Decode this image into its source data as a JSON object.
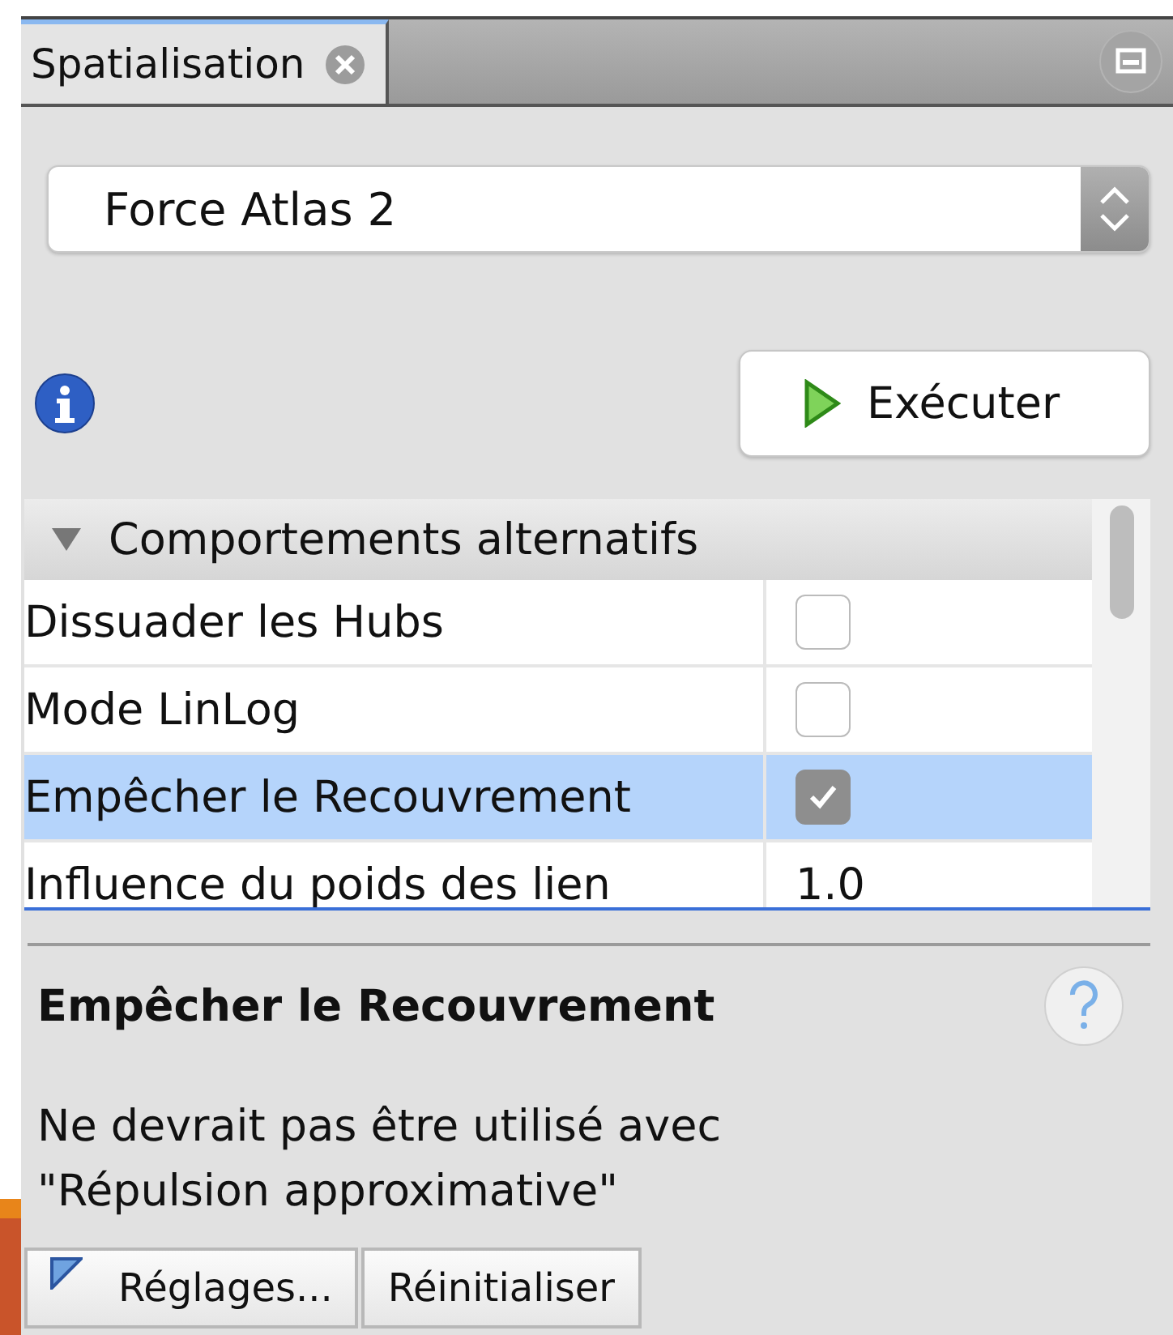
{
  "tab": {
    "label": "Spatialisation"
  },
  "algorithm_select": {
    "value": "Force Atlas 2"
  },
  "run_button": {
    "label": "Exécuter"
  },
  "properties": {
    "group": {
      "label": "Comportements alternatifs",
      "expanded": true
    },
    "rows": [
      {
        "name": "Dissuader les Hubs",
        "kind": "checkbox",
        "checked": false,
        "selected": false
      },
      {
        "name": "Mode LinLog",
        "kind": "checkbox",
        "checked": false,
        "selected": false
      },
      {
        "name": "Empêcher le Recouvrement",
        "kind": "checkbox",
        "checked": true,
        "selected": true
      },
      {
        "name": "Influence du poids des lien",
        "kind": "text",
        "value": "1.0",
        "selected": false
      }
    ]
  },
  "description": {
    "title": "Empêcher le Recouvrement",
    "lines": [
      "Ne devrait pas être utilisé avec",
      "\"Répulsion approximative\""
    ]
  },
  "buttons": [
    {
      "label": "Réglages...",
      "kind": "presets"
    },
    {
      "label": "Réinitialiser",
      "kind": "plain"
    }
  ]
}
